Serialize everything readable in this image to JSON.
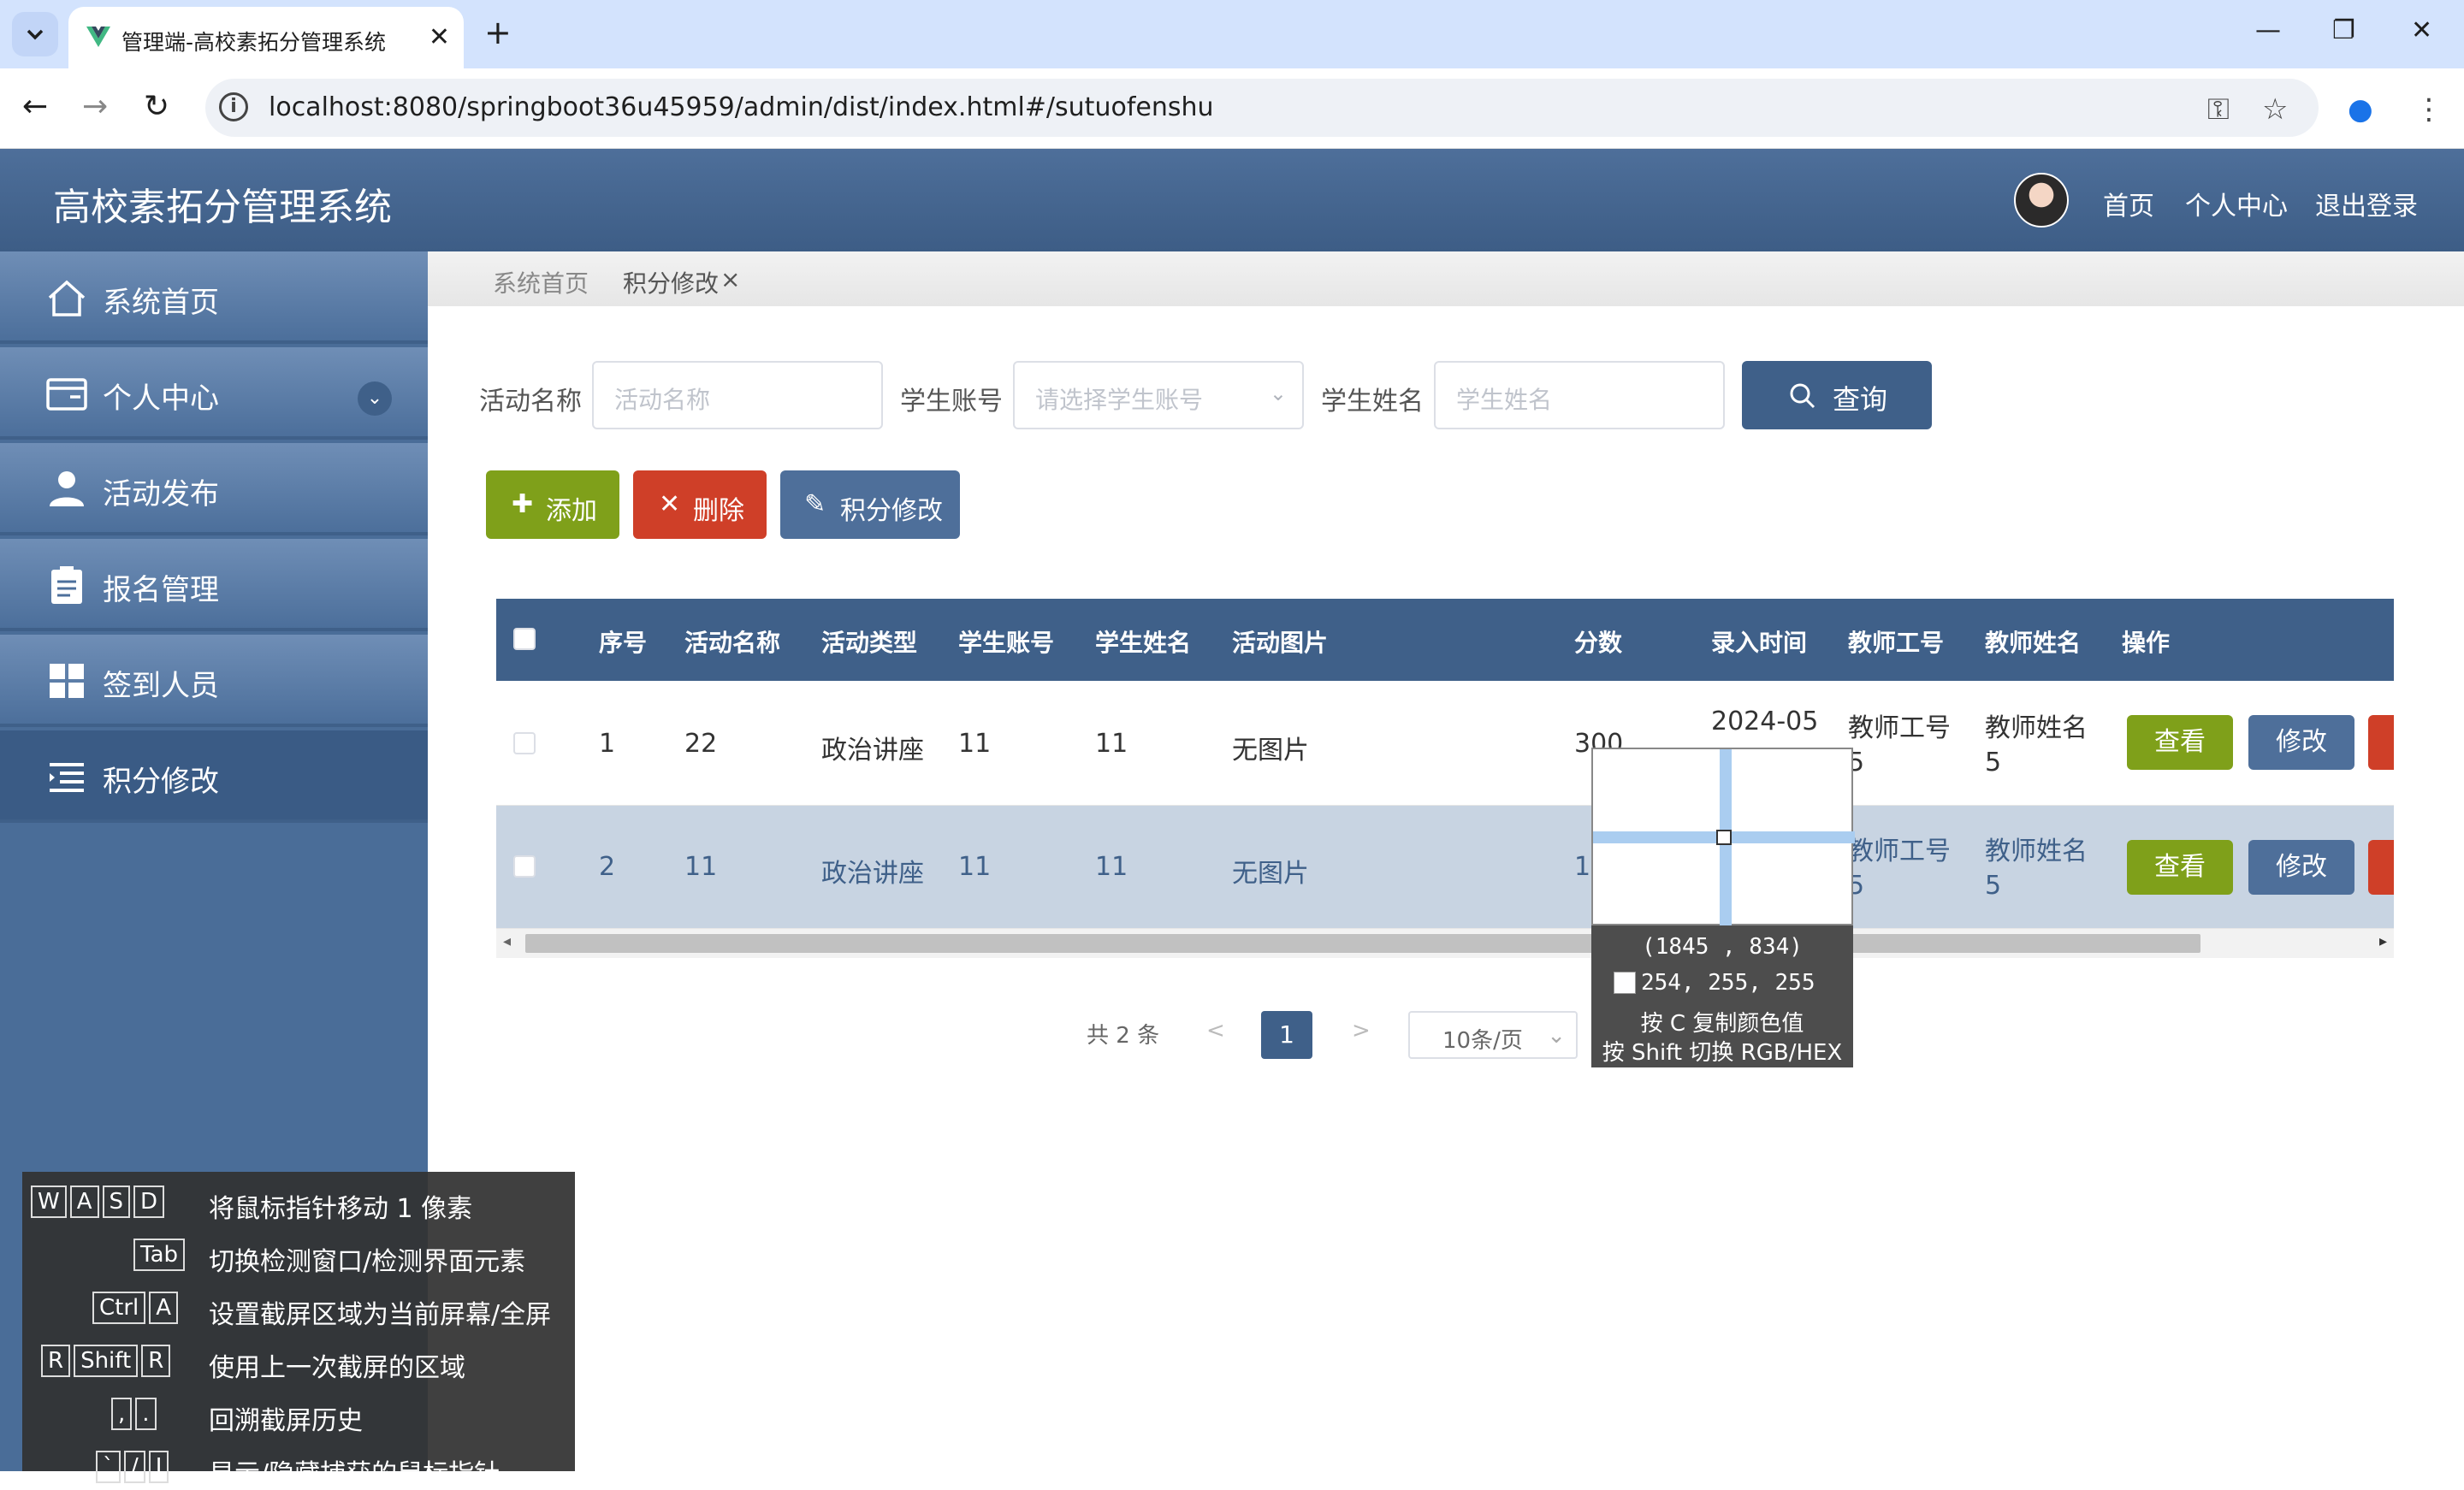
{
  "browser": {
    "tab_title": "管理端-高校素拓分管理系统",
    "url": "localhost:8080/springboot36u45959/admin/dist/index.html#/sutuofenshu"
  },
  "app": {
    "title": "高校素拓分管理系统",
    "header_links": [
      "首页",
      "个人中心",
      "退出登录"
    ]
  },
  "sidebar": {
    "items": [
      {
        "label": "系统首页",
        "icon": "home-icon"
      },
      {
        "label": "个人中心",
        "icon": "wallet-icon"
      },
      {
        "label": "活动发布",
        "icon": "user-icon"
      },
      {
        "label": "报名管理",
        "icon": "clipboard-icon"
      },
      {
        "label": "签到人员",
        "icon": "grid-icon"
      },
      {
        "label": "积分修改",
        "icon": "list-icon"
      }
    ]
  },
  "breadcrumb": {
    "home": "系统首页",
    "current": "积分修改",
    "close": "×"
  },
  "search": {
    "activity_label": "活动名称",
    "activity_placeholder": "活动名称",
    "account_label": "学生账号",
    "account_placeholder": "请选择学生账号",
    "name_label": "学生姓名",
    "name_placeholder": "学生姓名",
    "button": "查询"
  },
  "actions": {
    "add": "添加",
    "delete": "删除",
    "edit": "积分修改"
  },
  "table": {
    "headers": [
      "序号",
      "活动名称",
      "活动类型",
      "学生账号",
      "学生姓名",
      "活动图片",
      "分数",
      "录入时间",
      "教师工号",
      "教师姓名",
      "操作"
    ],
    "rows": [
      {
        "no": "1",
        "activity": "22",
        "type": "政治讲座",
        "account": "11",
        "name": "11",
        "image": "无图片",
        "score": "300",
        "time": "2024-05",
        "teacher_id_a": "教师工号",
        "teacher_id_b": "5",
        "teacher_name_a": "教师姓名",
        "teacher_name_b": "5"
      },
      {
        "no": "2",
        "activity": "11",
        "type": "政治讲座",
        "account": "11",
        "name": "11",
        "image": "无图片",
        "score": "10",
        "time": "",
        "teacher_id_a": "教师工号",
        "teacher_id_b": "5",
        "teacher_name_a": "教师姓名",
        "teacher_name_b": "5"
      }
    ],
    "view_label": "查看",
    "edit_label": "修改"
  },
  "pagination": {
    "total": "共 2 条",
    "prev": "<",
    "page": "1",
    "next": ">",
    "size": "10条/页"
  },
  "picker": {
    "coords": "(1845 , 834)",
    "rgb": "254, 255, 255",
    "hint_copy": "按 C 复制颜色值",
    "hint_switch": "按 Shift 切换 RGB/HEX"
  },
  "help": [
    {
      "keys": [
        "W",
        "A",
        "S",
        "D"
      ],
      "desc": "将鼠标指针移动 1 像素"
    },
    {
      "keys": [
        "Tab"
      ],
      "desc": "切换检测窗口/检测界面元素"
    },
    {
      "keys": [
        "Ctrl",
        "A"
      ],
      "desc": "设置截屏区域为当前屏幕/全屏"
    },
    {
      "keys": [
        "R",
        "Shift",
        "R"
      ],
      "desc": "使用上一次截屏的区域"
    },
    {
      "keys": [
        ",",
        "."
      ],
      "desc": "回溯截屏历史"
    },
    {
      "keys": [
        "`",
        "/",
        "I"
      ],
      "desc": "显示/隐藏捕获的鼠标指针"
    }
  ],
  "colors": {
    "primary": "#3f6089",
    "add": "#7fa01a",
    "delete": "#cf3f28",
    "header": "#4e6f9a"
  }
}
